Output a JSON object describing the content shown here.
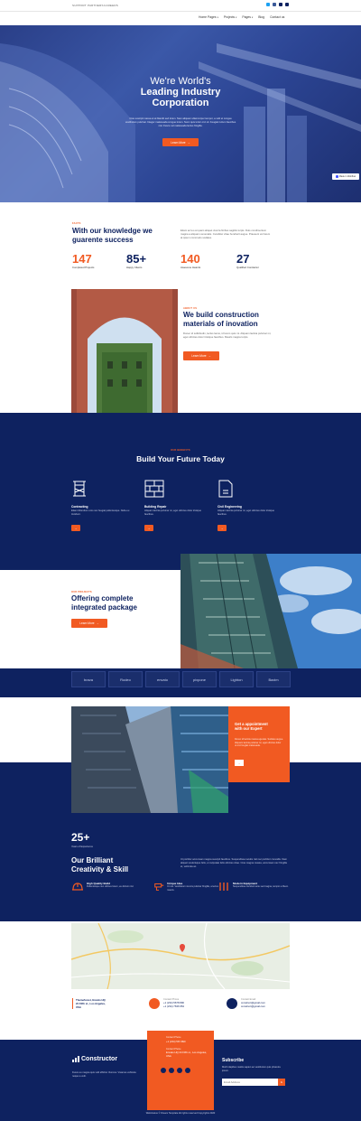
{
  "topbar": {
    "links": [
      "SUPPORT",
      "PARTNERS",
      "CAREERS"
    ],
    "social": [
      "twitter-icon",
      "facebook-icon",
      "linkedin-icon",
      "youtube-icon"
    ]
  },
  "nav": {
    "items": [
      {
        "label": "Home Pages",
        "dropdown": true
      },
      {
        "label": "Projects",
        "dropdown": true
      },
      {
        "label": "Pages",
        "dropdown": true
      },
      {
        "label": "Blog",
        "dropdown": false
      },
      {
        "label": "Contact us",
        "dropdown": false
      }
    ]
  },
  "hero": {
    "title_line1": "We're World's",
    "title_line2": "Leading Industry",
    "title_line3": "Corporation",
    "text": "Cras suscipit massa et at blandit sed lorem. Nam aliquam ullamcorper tempor, a velit et congue vestibulum pulvinar. Integer malesuada congue lorem. Nunc quis tortor orci sit. Feugiat rutrum faucibus nisi. Fusce vel malesuada lectus fringilla.",
    "button": "Learn More",
    "badge": "Made in Webflow"
  },
  "facts": {
    "eyebrow": "FACTS",
    "title_line1": "With our knowledge we",
    "title_line2": "guarente success",
    "text": "Etiam ac leo at quam aliquet viverra finibus sagittis turpis. Duis condimentum magna a aliquam venenatis. Curabitur vitae hendrerit augue. Praesent vel lorem at ipsum commodo sodales.",
    "stats": [
      {
        "value": "147",
        "label": "Completed Projects"
      },
      {
        "value": "85+",
        "label": "Happy Clients"
      },
      {
        "value": "140",
        "label": "Awesome Awards"
      },
      {
        "value": "27",
        "label": "Qualified Contractor"
      }
    ]
  },
  "about": {
    "eyebrow": "ABOUT US",
    "title_line1": "We build construction",
    "title_line2": "materials of inovation",
    "text": "Donec id sollicitudin, lectus lacus, id lorem quis mi. Aliquam lacinia pulvinar mi, eget ultricies dolor tristique faucibus. Mauris magna turpis.",
    "button": "Learn More"
  },
  "services": {
    "eyebrow": "OUR BENEFITS",
    "title": "Build Your Future Today",
    "items": [
      {
        "title": "Contracting",
        "desc": "Etiam bibendum eros nec feugiat pellentesque. Nulla eu tincidunt.",
        "icon": "crane-icon"
      },
      {
        "title": "Building Repair",
        "desc": "Aliquam lacinia pulvinar mi, eget ultricies dolor tristique faucibus.",
        "icon": "brick-wall-icon"
      },
      {
        "title": "Civil Engineering",
        "desc": "Aliquam lacinia pulvinar mi, eget ultricies dolor tristique faucibus.",
        "icon": "blueprint-icon"
      }
    ]
  },
  "projects": {
    "eyebrow": "OUR PROJECTS",
    "title_line1": "Offering complete",
    "title_line2": "integrated package",
    "button": "Learn More"
  },
  "partners": [
    "brava",
    "Rodeo",
    "envato",
    "pixpone",
    "Lighton",
    "Baxim"
  ],
  "appointment": {
    "title_line1": "Get a appointment",
    "title_line2": "with our Expert",
    "text": "Donec id lacinia massa egestas. Sodales augue. Aliquam lacinia pulvinar mi, eget ultricies dolor ut orci feugiat malesuada."
  },
  "experience": {
    "value": "25+",
    "label": "Years of Experience",
    "title_line1": "Our Brilliant",
    "title_line2": "Creativity & Skill",
    "text": "Ut porttitor accumsan magna suscipit faucibus. Suspendisse iaculis nisl nec porttitor convallis. Nam aliquet scelerisque felis, et vulputate felis ultricies vitae. Cras magna massa, accumsan nec fringilla et, vehicula ac.",
    "features": [
      {
        "title": "High Quality Build",
        "desc": "Pellentesque nec ultrices lorem, eu dictum nisl.",
        "icon": "hard-hat-icon"
      },
      {
        "title": "Unique Idea",
        "desc": "Ut nisi. Vestibulum viverra pulvinar fringilla, a lectus mauris.",
        "icon": "drill-icon"
      },
      {
        "title": "Modern Equipment",
        "desc": "Suspendisse tincidunt ante sed magna, tempor a libero.",
        "icon": "tools-icon"
      }
    ]
  },
  "contact": {
    "address_line1": "Themeforest, Envato HQ",
    "address_line2": "24 Fifth st., Los Angeles,",
    "address_line3": "USA",
    "phone_label": "Contact Phone",
    "phone1": "+1 (234) 5678 890",
    "phone2": "+1 (234) 7636 954",
    "email_label": "Contact Email",
    "email1": "construct@gmail.com",
    "email2": "construct@gmail.com"
  },
  "footer": {
    "brand": "Constructor",
    "tagline": "Fusce eu magna quis velit efficitur rhoncus. Vivamus vehicula neque a velit.",
    "social": [
      "facebook-icon",
      "twitter-icon",
      "linkedin-icon",
      "youtube-icon"
    ],
    "card_phone_label": "Contact Phone",
    "card_phone": "+1 (234) 567-890",
    "card_addr_label": "Contact Phone",
    "card_addr": "Envato HQ 24 Fifth st., Los Angeles, USA",
    "subscribe_title": "Subscribe",
    "subscribe_text": "Morbi dapibus mattis sapien ac vestibulum quis pharetra ipsum.",
    "email_placeholder": "Email Address",
    "copyright": "Webclusive © Dream Template All rights reserved Copyrights 2020"
  }
}
